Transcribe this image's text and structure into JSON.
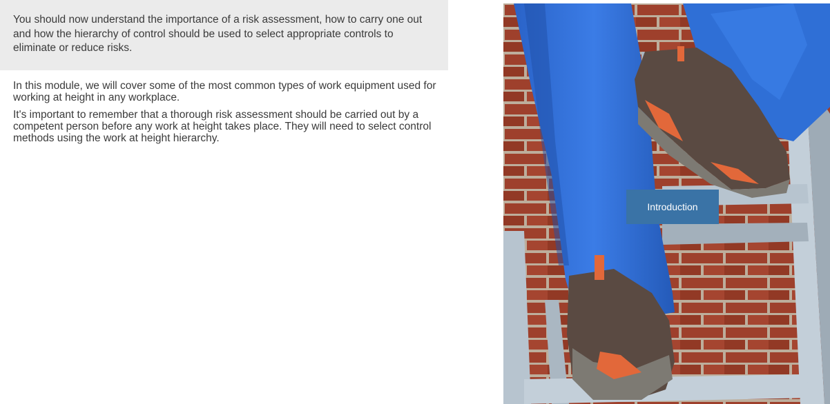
{
  "summary": {
    "text": "You should now understand the importance of a risk assessment, how to carry one out and how the hierarchy of control should be used to select appropriate controls to eliminate or reduce risks."
  },
  "content": {
    "paragraphs": [
      "In this module, we will cover some of the most common types of work equipment used for working at height in any workplace.",
      "It's important to remember that a thorough risk assessment should be carried out by a competent person before any work at height takes place. They will need to select control methods using the work at height hierarchy."
    ]
  },
  "hero": {
    "button_label": "Introduction",
    "colors": {
      "brick": "#a8452f",
      "mortar": "#c9b9a6",
      "trousers": "#2f6fd6",
      "ladder": "#b7c4cf",
      "shoe": "#5a4a42",
      "accent": "#e2683a",
      "button": "#3a73a6"
    }
  }
}
